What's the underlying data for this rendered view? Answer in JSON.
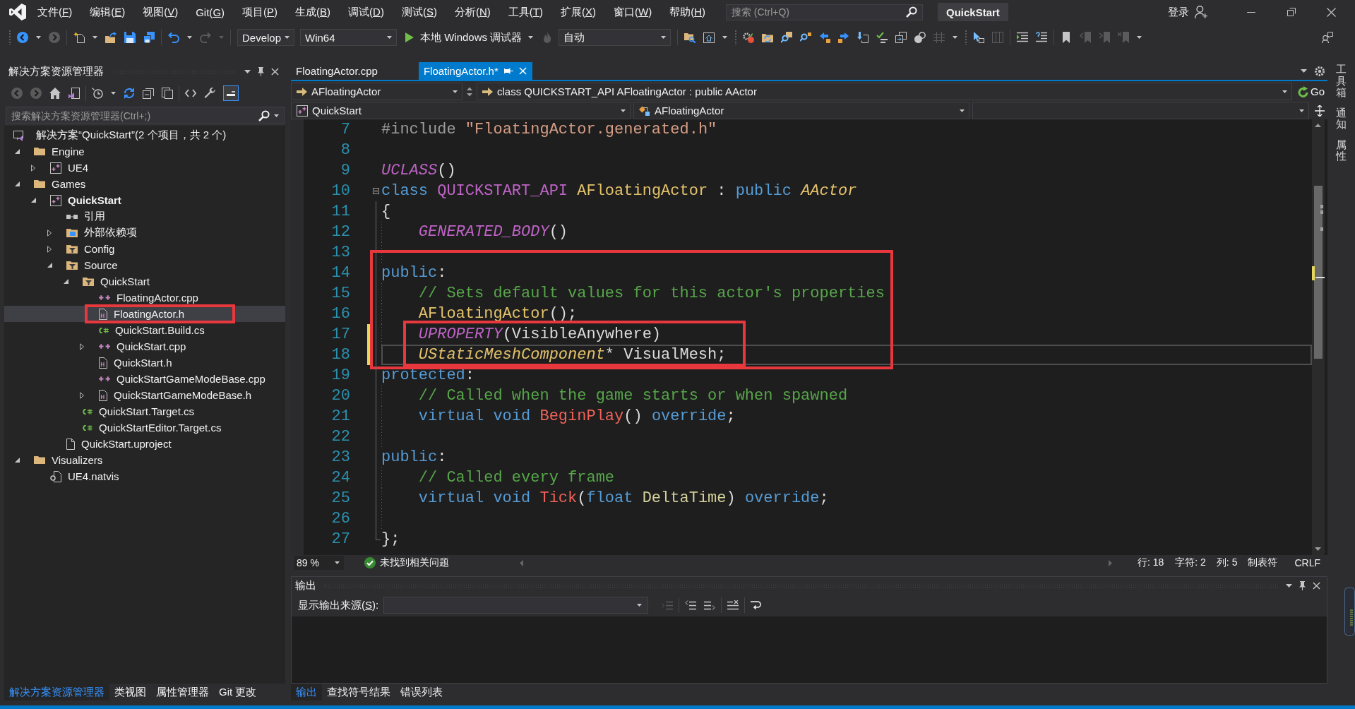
{
  "title_bar": {
    "menus": [
      {
        "prefix": "文件(",
        "access_key": "F",
        "suffix": ")"
      },
      {
        "prefix": "编辑(",
        "access_key": "E",
        "suffix": ")"
      },
      {
        "prefix": "视图(",
        "access_key": "V",
        "suffix": ")"
      },
      {
        "prefix": "Git(",
        "access_key": "G",
        "suffix": ")"
      },
      {
        "prefix": "项目(",
        "access_key": "P",
        "suffix": ")"
      },
      {
        "prefix": "生成(",
        "access_key": "B",
        "suffix": ")"
      },
      {
        "prefix": "调试(",
        "access_key": "D",
        "suffix": ")"
      },
      {
        "prefix": "测试(",
        "access_key": "S",
        "suffix": ")"
      },
      {
        "prefix": "分析(",
        "access_key": "N",
        "suffix": ")"
      },
      {
        "prefix": "工具(",
        "access_key": "T",
        "suffix": ")"
      },
      {
        "prefix": "扩展(",
        "access_key": "X",
        "suffix": ")"
      },
      {
        "prefix": "窗口(",
        "access_key": "W",
        "suffix": ")"
      },
      {
        "prefix": "帮助(",
        "access_key": "H",
        "suffix": ")"
      }
    ],
    "search": {
      "placeholder": "搜索 (Ctrl+Q)"
    },
    "solution_name": "QuickStart",
    "sign_in": "登录"
  },
  "toolbar": {
    "groups": [
      {
        "items": [
          {
            "kind": "back",
            "disabled": false
          },
          {
            "kind": "caret",
            "disabled": false
          },
          {
            "kind": "forward",
            "disabled": true
          }
        ]
      },
      {
        "items": [
          {
            "kind": "new-item",
            "disabled": false
          },
          {
            "kind": "caret",
            "disabled": false
          },
          {
            "kind": "open",
            "disabled": false
          },
          {
            "kind": "save",
            "disabled": false
          },
          {
            "kind": "save-all",
            "disabled": false
          }
        ]
      },
      {
        "items": [
          {
            "kind": "undo",
            "disabled": false
          },
          {
            "kind": "caret",
            "disabled": false
          },
          {
            "kind": "redo",
            "disabled": true
          },
          {
            "kind": "caret",
            "disabled": true
          }
        ]
      },
      {
        "items": [
          {
            "kind": "combo",
            "value": "Develop"
          },
          {
            "kind": "combo",
            "value": "Win64"
          },
          {
            "kind": "run",
            "label": "本地 Windows 调试器"
          },
          {
            "kind": "flame",
            "disabled": true
          },
          {
            "kind": "combo",
            "value": "自动"
          }
        ]
      },
      {
        "items": [
          {
            "kind": "folder-search",
            "disabled": false
          },
          {
            "kind": "home-window",
            "disabled": false
          },
          {
            "kind": "caret",
            "disabled": false
          }
        ]
      },
      {
        "items": [
          {
            "kind": "build",
            "disabled": false
          },
          {
            "kind": "folder-sync",
            "disabled": false
          },
          {
            "kind": "find-window",
            "disabled": false
          },
          {
            "kind": "find-symbol",
            "disabled": false
          },
          {
            "kind": "go-back-def",
            "disabled": false
          },
          {
            "kind": "go-forward-def",
            "disabled": false
          },
          {
            "kind": "step-into",
            "disabled": false
          },
          {
            "kind": "spell-check",
            "disabled": false
          },
          {
            "kind": "copy-window",
            "disabled": false
          },
          {
            "kind": "toggle-shapes",
            "disabled": false
          },
          {
            "kind": "grid",
            "disabled": true
          },
          {
            "kind": "caret",
            "disabled": false
          }
        ]
      },
      {
        "items": [
          {
            "kind": "pointer",
            "disabled": false
          },
          {
            "kind": "columns",
            "disabled": true
          }
        ]
      },
      {
        "items": [
          {
            "kind": "indent",
            "disabled": false
          },
          {
            "kind": "comment",
            "disabled": false
          }
        ]
      },
      {
        "items": [
          {
            "kind": "bookmark",
            "disabled": false
          },
          {
            "kind": "bookmark-prev",
            "disabled": true
          },
          {
            "kind": "bookmark-next",
            "disabled": true
          },
          {
            "kind": "bookmark-clear",
            "disabled": true
          },
          {
            "kind": "caret",
            "disabled": false
          }
        ]
      }
    ]
  },
  "solution_explorer": {
    "title": "解决方案资源管理器",
    "tool_groups": [
      {
        "items": [
          {
            "kind": "back",
            "disabled": true
          },
          {
            "kind": "forward",
            "disabled": true
          },
          {
            "kind": "home",
            "disabled": false
          },
          {
            "kind": "switch-views",
            "disabled": false
          }
        ]
      },
      {
        "items": [
          {
            "kind": "history",
            "disabled": false
          },
          {
            "kind": "caret",
            "disabled": false
          },
          {
            "kind": "sync",
            "disabled": false
          },
          {
            "kind": "collapse-all",
            "disabled": false
          },
          {
            "kind": "show-all",
            "disabled": false
          }
        ]
      },
      {
        "items": [
          {
            "kind": "code",
            "disabled": false
          },
          {
            "kind": "properties",
            "disabled": false
          },
          {
            "kind": "preview",
            "disabled": false,
            "on": true
          }
        ]
      }
    ],
    "search": {
      "placeholder": "搜索解决方案资源管理器(Ctrl+;)"
    },
    "solution": {
      "label": "解决方案“QuickStart”(2 个项目，共 2 个)",
      "selected": false
    },
    "tree": [
      {
        "label": "Engine",
        "kind": "folder",
        "expanded": true,
        "selected": false,
        "children": [
          {
            "label": "UE4",
            "kind": "project",
            "expanded": false,
            "selected": false
          }
        ]
      },
      {
        "label": "Games",
        "kind": "folder",
        "expanded": true,
        "selected": false,
        "children": [
          {
            "label": "QuickStart",
            "kind": "project",
            "startup": true,
            "expanded": true,
            "selected": false,
            "children": [
              {
                "label": "引用",
                "kind": "references",
                "selected": false
              },
              {
                "label": "外部依赖项",
                "kind": "dependencies",
                "expanded": false,
                "selected": false
              },
              {
                "label": "Config",
                "kind": "filter",
                "expanded": false,
                "selected": false
              },
              {
                "label": "Source",
                "kind": "filter",
                "expanded": true,
                "selected": false,
                "children": [
                  {
                    "label": "QuickStart",
                    "kind": "filter",
                    "expanded": true,
                    "selected": false,
                    "children": [
                      {
                        "label": "FloatingActor.cpp",
                        "kind": "cpp",
                        "selected": false
                      },
                      {
                        "label": "FloatingActor.h",
                        "kind": "header",
                        "selected": true,
                        "callout": true
                      },
                      {
                        "label": "QuickStart.Build.cs",
                        "kind": "csharp",
                        "selected": false
                      },
                      {
                        "label": "QuickStart.cpp",
                        "kind": "cpp",
                        "expanded": false,
                        "selected": false
                      },
                      {
                        "label": "QuickStart.h",
                        "kind": "header",
                        "selected": false
                      },
                      {
                        "label": "QuickStartGameModeBase.cpp",
                        "kind": "cpp",
                        "selected": false
                      },
                      {
                        "label": "QuickStartGameModeBase.h",
                        "kind": "header",
                        "expanded": false,
                        "selected": false
                      }
                    ]
                  },
                  {
                    "label": "QuickStart.Target.cs",
                    "kind": "csharp",
                    "selected": false
                  },
                  {
                    "label": "QuickStartEditor.Target.cs",
                    "kind": "csharp",
                    "selected": false
                  }
                ]
              },
              {
                "label": "QuickStart.uproject",
                "kind": "file",
                "selected": false
              }
            ]
          }
        ]
      },
      {
        "label": "Visualizers",
        "kind": "folder",
        "expanded": true,
        "selected": false,
        "children": [
          {
            "label": "UE4.natvis",
            "kind": "natvis",
            "selected": false
          }
        ]
      }
    ],
    "tabs": [
      {
        "label": "解决方案资源管理器",
        "selected": true
      },
      {
        "label": "类视图",
        "selected": false
      },
      {
        "label": "属性管理器",
        "selected": false
      },
      {
        "label": "Git 更改",
        "selected": false
      }
    ]
  },
  "editor": {
    "tabs": [
      {
        "label": "FloatingActor.cpp",
        "selected": false
      },
      {
        "label": "FloatingActor.h*",
        "selected": true
      }
    ],
    "navigation": {
      "scope": "AFloatingActor",
      "declaration": "class QUICKSTART_API AFloatingActor : public AActor",
      "go": "Go",
      "project": "QuickStart",
      "member": "AFloatingActor"
    },
    "lines": [
      {
        "kind": "line",
        "number": "7",
        "indented": false,
        "modified": false,
        "current": false,
        "tokens": [
          {
            "text": "#include ",
            "kind": "directive"
          },
          {
            "text": "\"FloatingActor.generated.h\"",
            "kind": "string"
          }
        ]
      },
      {
        "kind": "line",
        "number": "8",
        "modified": false,
        "current": false
      },
      {
        "kind": "line",
        "number": "9",
        "indented": false,
        "modified": false,
        "current": false,
        "tokens": [
          {
            "text": "UCLASS",
            "kind": "macro"
          },
          {
            "text": "()",
            "kind": "plain"
          }
        ]
      },
      {
        "kind": "line",
        "number": "10",
        "indented": false,
        "modified": false,
        "current": false,
        "fold_open": true,
        "tokens": [
          {
            "text": "class ",
            "kind": "keyword"
          },
          {
            "text": "QUICKSTART_API ",
            "kind": "api_macro"
          },
          {
            "text": "AFloatingActor",
            "kind": "class_name"
          },
          {
            "text": " : ",
            "kind": "plain"
          },
          {
            "text": "public ",
            "kind": "keyword"
          },
          {
            "text": "AActor",
            "kind": "class_ref"
          }
        ]
      },
      {
        "kind": "line",
        "number": "11",
        "indented": false,
        "modified": false,
        "current": false,
        "tokens": [
          {
            "text": "{",
            "kind": "plain"
          }
        ]
      },
      {
        "kind": "line",
        "number": "12",
        "indented": true,
        "modified": false,
        "current": false,
        "tokens": [
          {
            "text": "GENERATED_BODY",
            "kind": "macro"
          },
          {
            "text": "()",
            "kind": "plain"
          }
        ]
      },
      {
        "kind": "line",
        "number": "13",
        "modified": false,
        "current": false
      },
      {
        "kind": "callout",
        "lines": [
          {
            "kind": "line",
            "number": "14",
            "indented": false,
            "modified": false,
            "current": false,
            "tokens": [
              {
                "text": "public",
                "kind": "keyword"
              },
              {
                "text": ":",
                "kind": "plain"
              }
            ]
          },
          {
            "kind": "line",
            "number": "15",
            "indented": true,
            "modified": false,
            "current": false,
            "tokens": [
              {
                "text": "// Sets default values for this actor's properties",
                "kind": "comment"
              }
            ]
          },
          {
            "kind": "line",
            "number": "16",
            "indented": true,
            "modified": false,
            "current": false,
            "tokens": [
              {
                "text": "AFloatingActor",
                "kind": "class_name"
              },
              {
                "text": "();",
                "kind": "plain"
              }
            ]
          },
          {
            "kind": "callout",
            "lines": [
              {
                "kind": "line",
                "number": "17",
                "indented": true,
                "modified": true,
                "current": false,
                "tokens": [
                  {
                    "text": "UPROPERTY",
                    "kind": "macro"
                  },
                  {
                    "text": "(VisibleAnywhere)",
                    "kind": "plain"
                  }
                ]
              },
              {
                "kind": "line",
                "number": "18",
                "indented": true,
                "modified": true,
                "current": true,
                "tokens": [
                  {
                    "text": "UStaticMeshComponent",
                    "kind": "class_ref"
                  },
                  {
                    "text": "* VisualMesh;",
                    "kind": "plain"
                  }
                ]
              }
            ]
          }
        ]
      },
      {
        "kind": "line",
        "number": "19",
        "indented": false,
        "modified": false,
        "current": false,
        "tokens": [
          {
            "text": "protected",
            "kind": "keyword"
          },
          {
            "text": ":",
            "kind": "plain"
          }
        ]
      },
      {
        "kind": "line",
        "number": "20",
        "indented": true,
        "modified": false,
        "current": false,
        "tokens": [
          {
            "text": "// Called when the game starts or when spawned",
            "kind": "comment"
          }
        ]
      },
      {
        "kind": "line",
        "number": "21",
        "indented": true,
        "modified": false,
        "current": false,
        "tokens": [
          {
            "text": "virtual void ",
            "kind": "keyword"
          },
          {
            "text": "BeginPlay",
            "kind": "function"
          },
          {
            "text": "() ",
            "kind": "plain"
          },
          {
            "text": "override",
            "kind": "keyword"
          },
          {
            "text": ";",
            "kind": "plain"
          }
        ]
      },
      {
        "kind": "line",
        "number": "22",
        "modified": false,
        "current": false
      },
      {
        "kind": "line",
        "number": "23",
        "indented": false,
        "modified": false,
        "current": false,
        "tokens": [
          {
            "text": "public",
            "kind": "keyword"
          },
          {
            "text": ":",
            "kind": "plain"
          }
        ]
      },
      {
        "kind": "line",
        "number": "24",
        "indented": true,
        "modified": false,
        "current": false,
        "tokens": [
          {
            "text": "// Called every frame",
            "kind": "comment"
          }
        ]
      },
      {
        "kind": "line",
        "number": "25",
        "indented": true,
        "modified": false,
        "current": false,
        "tokens": [
          {
            "text": "virtual void ",
            "kind": "keyword"
          },
          {
            "text": "Tick",
            "kind": "function"
          },
          {
            "text": "(",
            "kind": "plain"
          },
          {
            "text": "float ",
            "kind": "keyword"
          },
          {
            "text": "DeltaTime",
            "kind": "parameter"
          },
          {
            "text": ") ",
            "kind": "plain"
          },
          {
            "text": "override",
            "kind": "keyword"
          },
          {
            "text": ";",
            "kind": "plain"
          }
        ]
      },
      {
        "kind": "line",
        "number": "26",
        "modified": false,
        "current": false
      },
      {
        "kind": "line",
        "number": "27",
        "indented": false,
        "modified": false,
        "current": false,
        "tokens": [
          {
            "text": "};",
            "kind": "plain"
          }
        ]
      }
    ],
    "status": {
      "zoom": "89 %",
      "issues": "未找到相关问题",
      "line": "行: 18",
      "character": "字符: 2",
      "column": "列: 5",
      "indentation": "制表符",
      "line_endings": "CRLF"
    }
  },
  "output": {
    "title": "输出",
    "source_label": {
      "prefix": "显示输出来源(",
      "access_key": "S",
      "suffix": "):"
    },
    "tool_groups": [
      {
        "items": [
          {
            "kind": "go-to-line",
            "disabled": true
          }
        ]
      },
      {
        "items": [
          {
            "kind": "previous-message",
            "disabled": false
          },
          {
            "kind": "next-message",
            "disabled": false
          }
        ]
      },
      {
        "items": [
          {
            "kind": "clear-all",
            "disabled": false
          }
        ]
      },
      {
        "items": [
          {
            "kind": "word-wrap",
            "disabled": false
          }
        ]
      }
    ],
    "tabs": [
      {
        "label": "输出",
        "selected": true
      },
      {
        "label": "查找符号结果",
        "selected": false
      },
      {
        "label": "错误列表",
        "selected": false
      }
    ]
  },
  "side_tabs": [
    "工具箱",
    "通知",
    "属性"
  ]
}
